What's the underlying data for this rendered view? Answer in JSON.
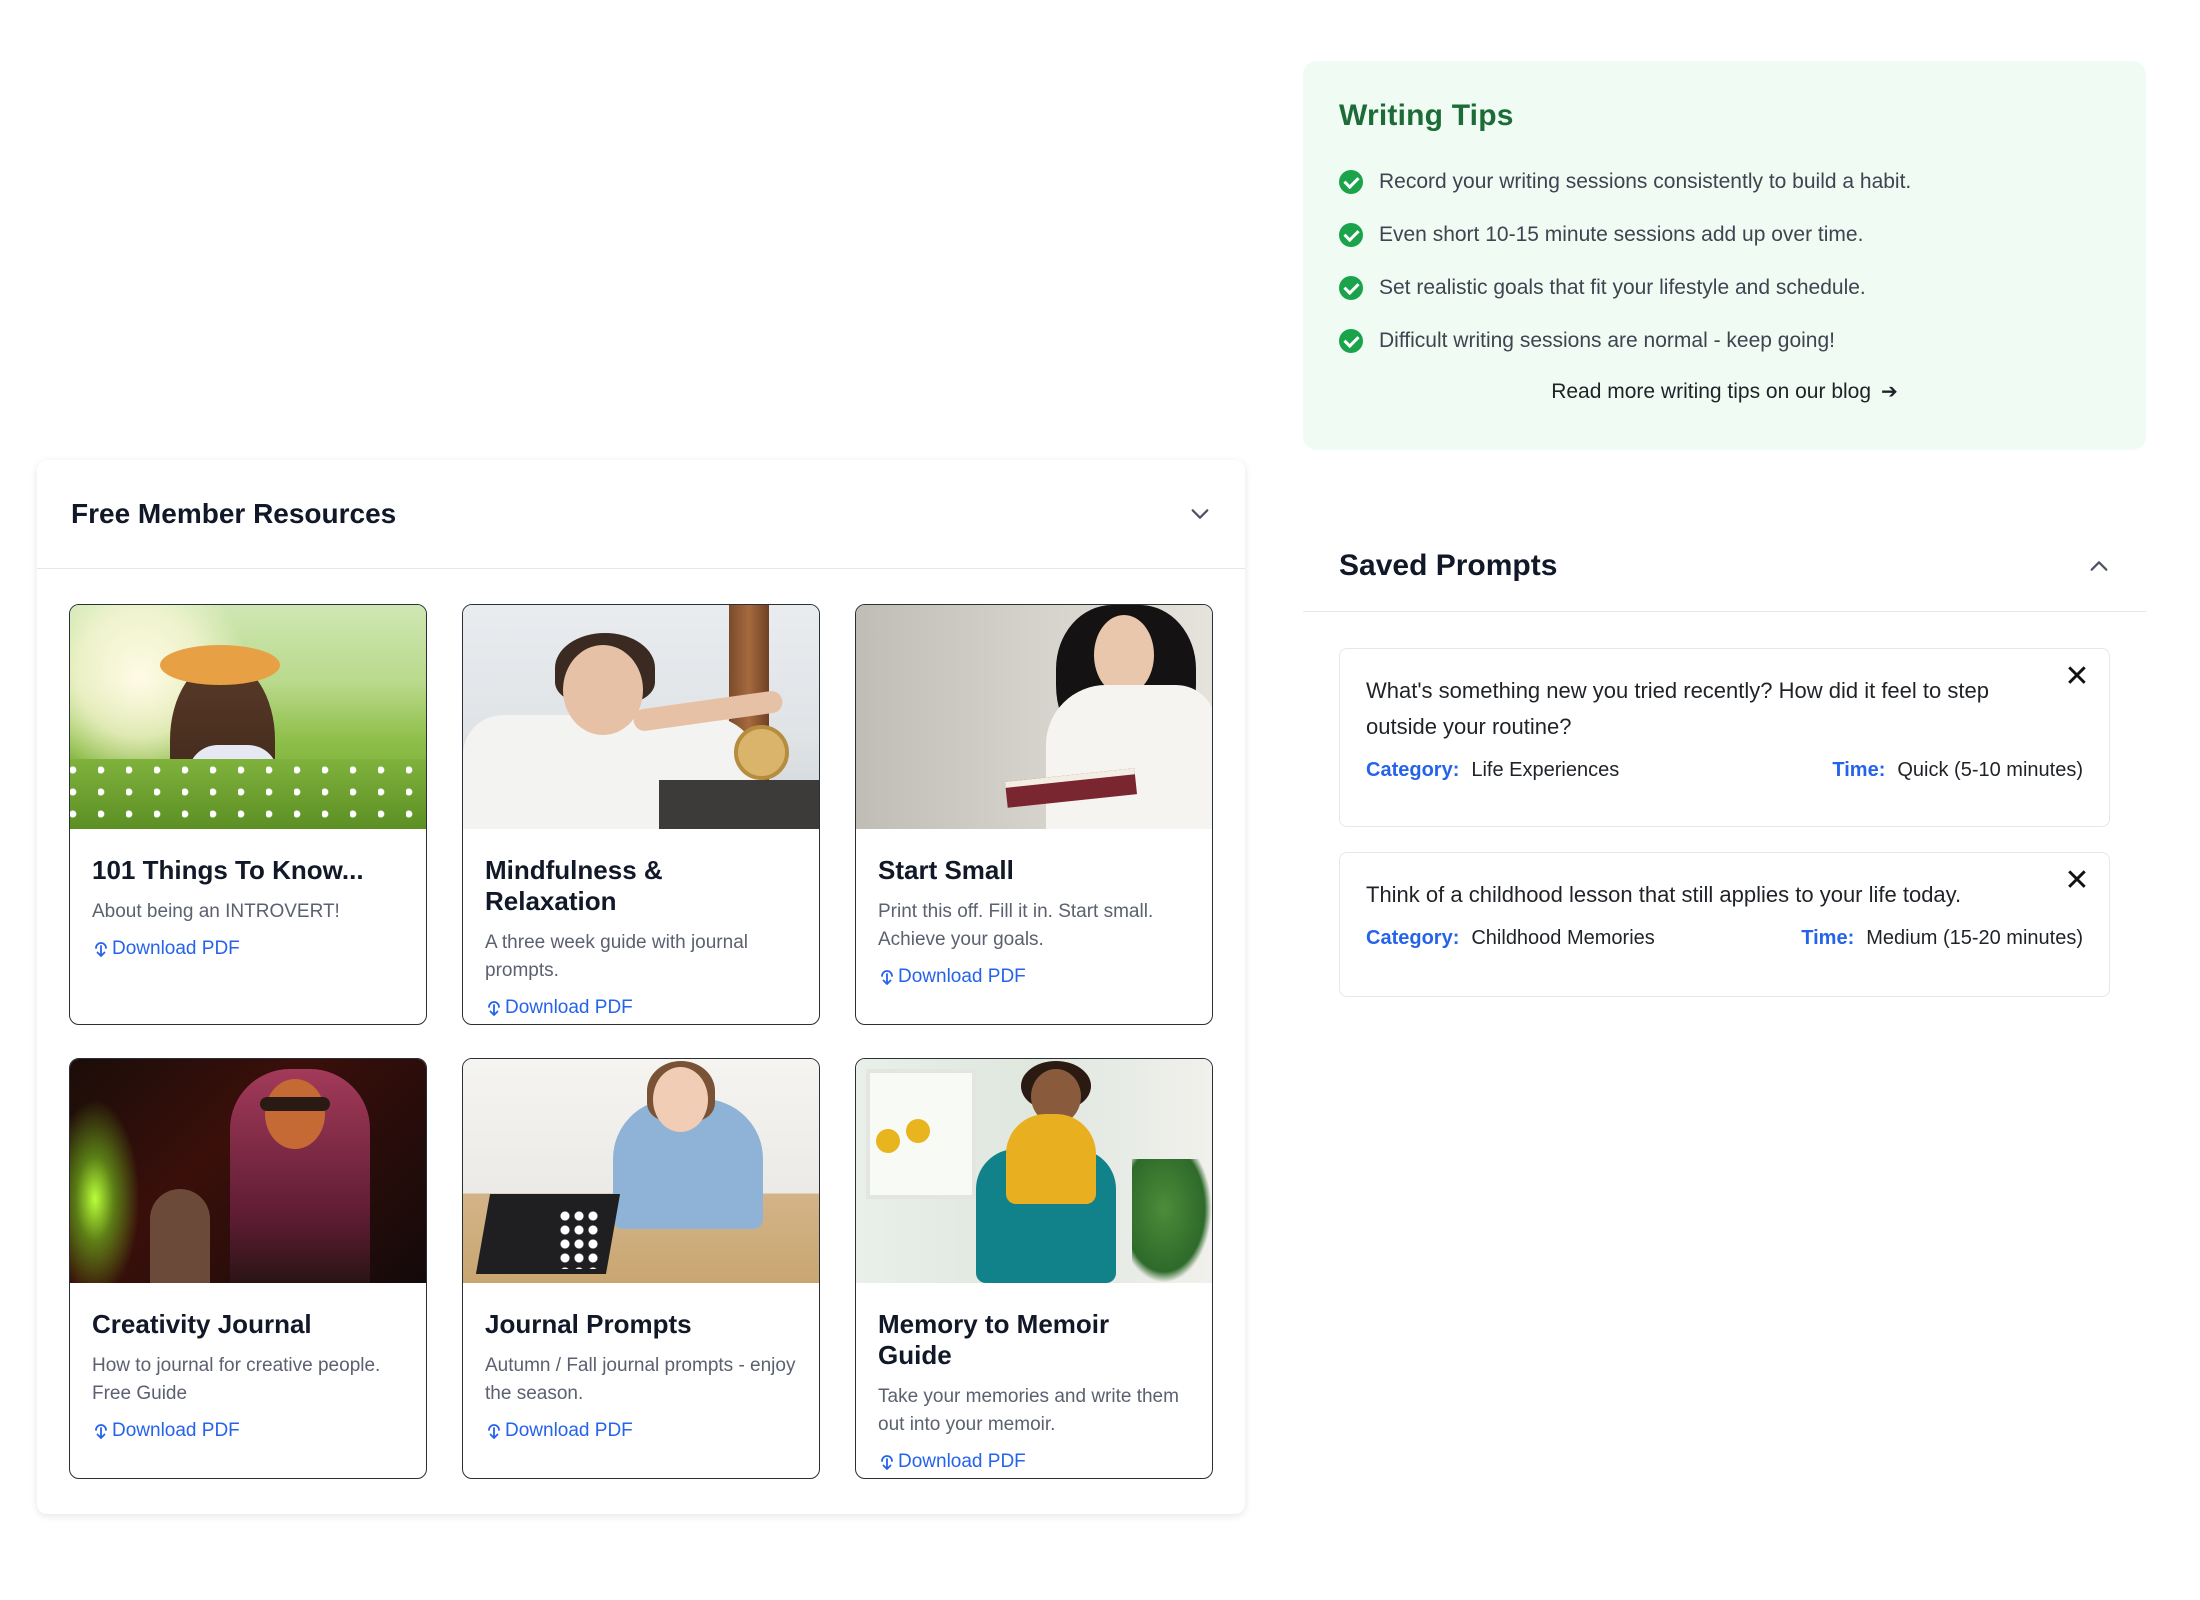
{
  "writing_tips": {
    "title": "Writing Tips",
    "items": [
      "Record your writing sessions consistently to build a habit.",
      "Even short 10-15 minute sessions add up over time.",
      "Set realistic goals that fit your lifestyle and schedule.",
      "Difficult writing sessions are normal - keep going!"
    ],
    "link_label": "Read more writing tips on our blog"
  },
  "resources": {
    "title": "Free Member Resources",
    "download_label": "Download PDF",
    "cards": [
      {
        "title": "101 Things To Know...",
        "desc": "About being an INTROVERT!"
      },
      {
        "title": "Mindfulness & Relaxation",
        "desc": "A three week guide with journal prompts."
      },
      {
        "title": "Start Small",
        "desc": "Print this off. Fill it in. Start small. Achieve your goals."
      },
      {
        "title": "Creativity Journal",
        "desc": "How to journal for creative people. Free Guide"
      },
      {
        "title": "Journal Prompts",
        "desc": "Autumn / Fall journal prompts - enjoy the season."
      },
      {
        "title": "Memory to Memoir Guide",
        "desc": "Take your memories and write them out into your memoir."
      }
    ]
  },
  "saved_prompts": {
    "title": "Saved Prompts",
    "category_label": "Category:",
    "time_label": "Time:",
    "items": [
      {
        "text": "What's something new you tried recently? How did it feel to step outside your routine?",
        "category": "Life Experiences",
        "time": "Quick (5-10 minutes)"
      },
      {
        "text": "Think of a childhood lesson that still applies to your life today.",
        "category": "Childhood Memories",
        "time": "Medium (15-20 minutes)"
      }
    ]
  },
  "colors": {
    "tips_bg": "#effbf3",
    "tips_title": "#1d6b37",
    "check": "#1aa34a",
    "link_blue": "#2563eb"
  }
}
